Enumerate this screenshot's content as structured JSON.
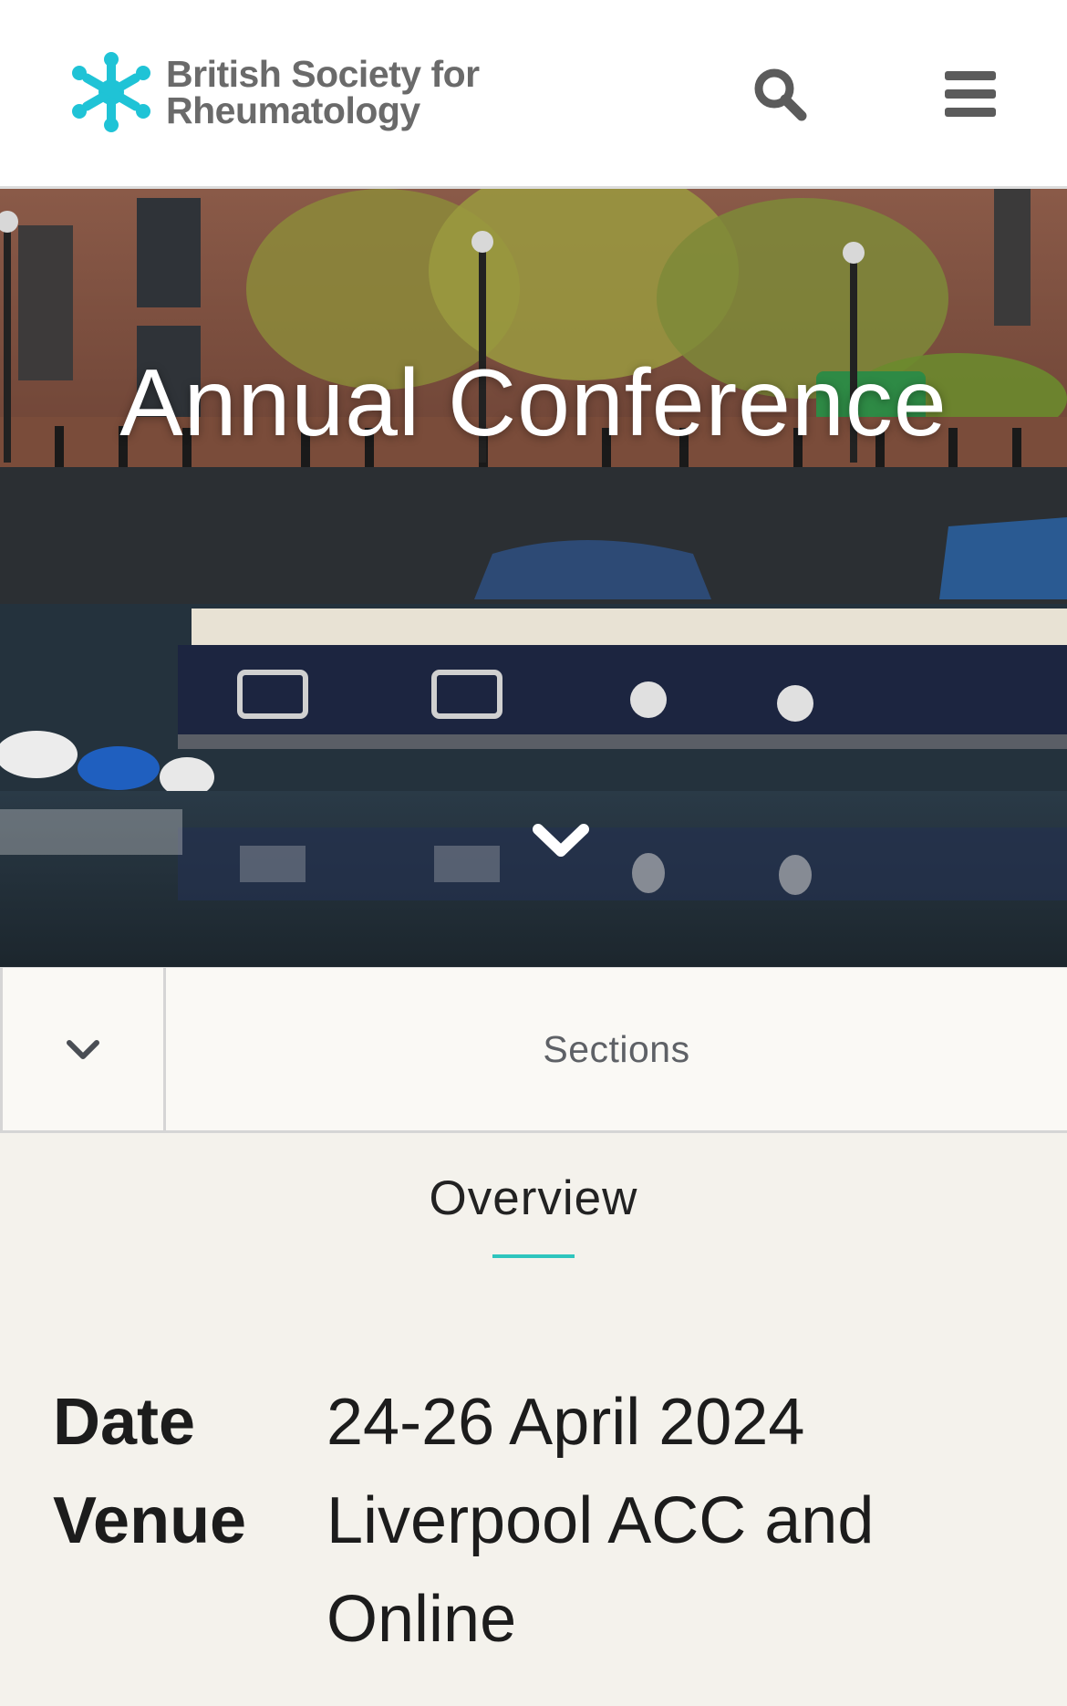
{
  "header": {
    "logo_line1": "British Society for",
    "logo_line2": "Rheumatology",
    "brand_color": "#1fc3d6",
    "search_icon": "search-icon",
    "menu_icon": "hamburger-menu-icon"
  },
  "hero": {
    "title": "Annual Conference",
    "scroll_icon": "chevron-down-icon"
  },
  "sections_bar": {
    "label": "Sections",
    "toggle_icon": "chevron-down-icon"
  },
  "tabs": {
    "active": "Overview",
    "accent_color": "#2ec5bd"
  },
  "details": [
    {
      "label": "Date",
      "value": "24-26 April 2024"
    },
    {
      "label": "Venue",
      "value": "Liverpool ACC and Online"
    }
  ]
}
